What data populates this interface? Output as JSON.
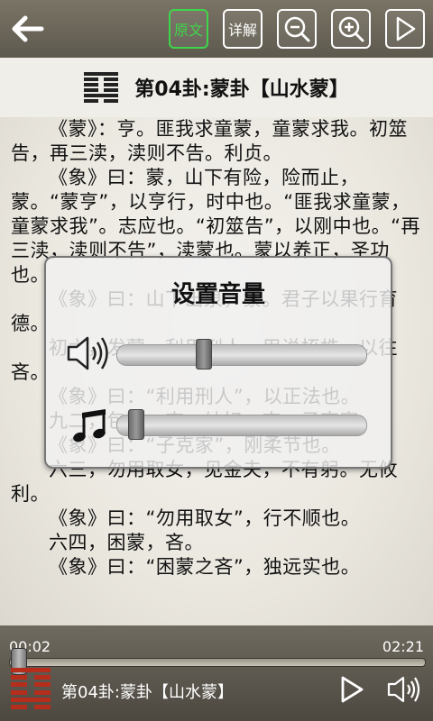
{
  "toolbar": {
    "original_label": "原文",
    "explain_label": "详解"
  },
  "header": {
    "title": "第04卦:蒙卦【山水蒙】"
  },
  "content": {
    "paragraphs": [
      "《蒙》：亨。匪我求童蒙，童蒙求我。初筮告，再三渎，渎则不告。利贞。",
      "《象》曰：蒙，山下有险，险而止，蒙。“蒙亨”，以亨行，时中也。“匪我求童蒙，童蒙求我”。志应也。“初筮告”，以刚中也。“再三渎，渎则不告”，渎蒙也。蒙以养正，圣功也。",
      "《象》曰：山下出泉，蒙。君子以果行育德。",
      "初六，发蒙，利用刑人，用说桎梏，以往吝。",
      "《象》曰：“利用刑人”，以正法也。",
      "九二，包蒙，吉。纳妇，吉。子克家。",
      "《象》曰：“子克家”，刚柔节也。",
      "六三，勿用取女，见金夫，不有躬。无攸利。",
      "《象》曰：“勿用取女”，行不顺也。",
      "六四，困蒙，吝。",
      "《象》曰：“困蒙之吝”，独远实也。"
    ]
  },
  "volume_dialog": {
    "title": "设置音量",
    "voice_level": 0.34,
    "music_level": 0.05
  },
  "player": {
    "elapsed": "00:02",
    "duration": "02:21",
    "progress": 0.014,
    "now_playing": "第04卦:蒙卦【山水蒙】"
  },
  "hexagram_lines_top_to_bottom": [
    "solid",
    "broken",
    "broken",
    "broken",
    "solid",
    "broken"
  ],
  "colors": {
    "active_button": "#3ed64a",
    "hexagram_bottom": "#b72d1c"
  }
}
